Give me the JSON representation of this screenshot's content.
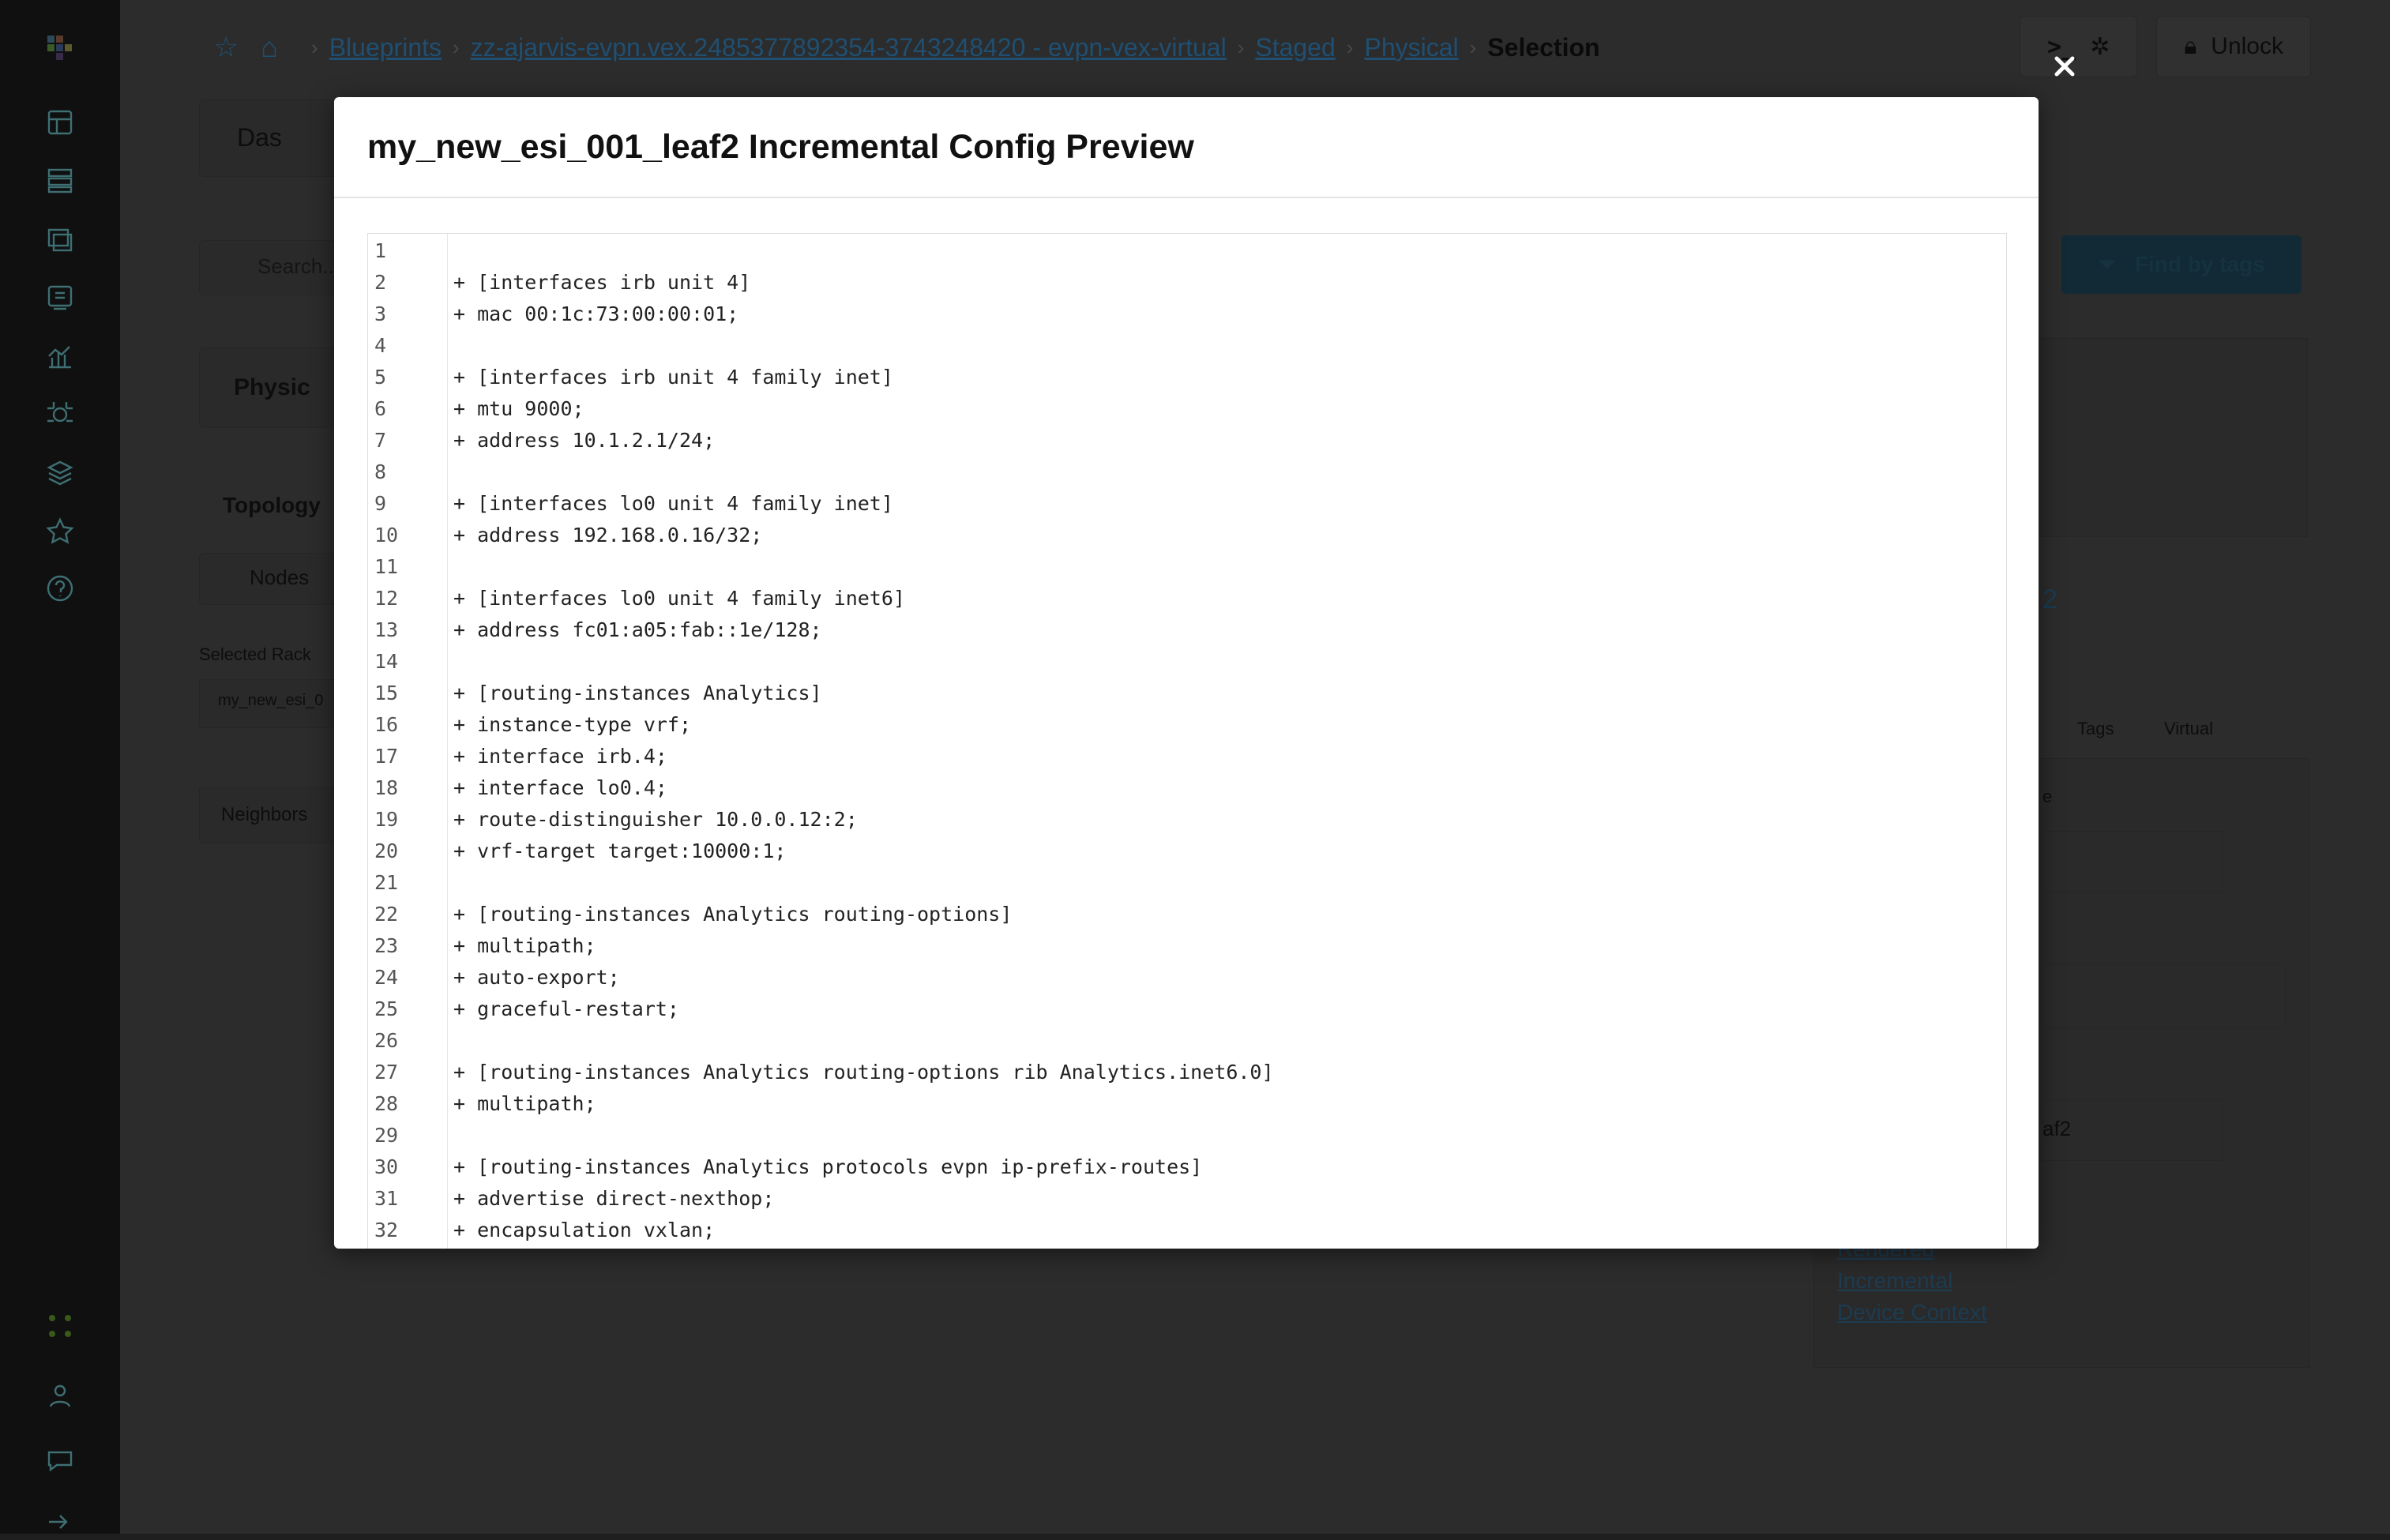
{
  "breadcrumb": {
    "items": [
      "Blueprints",
      "zz-ajarvis-evpn.vex.2485377892354-3743248420 - evpn-vex-virtual",
      "Staged",
      "Physical"
    ],
    "current": "Selection"
  },
  "header": {
    "unlock_label": "Unlock"
  },
  "background": {
    "dashboard_tab": "Das",
    "search_placeholder": "Search...",
    "find_by_tags": "Find by tags",
    "physical_tab": "Physic",
    "topology_tab": "Topology",
    "nodes_button": "Nodes",
    "selected_rack_label": "Selected Rack",
    "selected_rack_value": "my_new_esi_0",
    "neighbors_tab": "Neighbors",
    "device_link": "2",
    "col_tags": "Tags",
    "col_virtual": "Virtual",
    "col_e": "e",
    "row_leaf2": "af2",
    "links": [
      "Rendered",
      "Incremental",
      "Device Context"
    ]
  },
  "modal": {
    "title": "my_new_esi_001_leaf2 Incremental Config Preview",
    "lines": [
      {
        "n": "1",
        "t": ""
      },
      {
        "n": "2",
        "t": "+ [interfaces irb unit 4]"
      },
      {
        "n": "3",
        "t": "+ mac 00:1c:73:00:00:01;"
      },
      {
        "n": "4",
        "t": ""
      },
      {
        "n": "5",
        "t": "+ [interfaces irb unit 4 family inet]"
      },
      {
        "n": "6",
        "t": "+ mtu 9000;"
      },
      {
        "n": "7",
        "t": "+ address 10.1.2.1/24;"
      },
      {
        "n": "8",
        "t": ""
      },
      {
        "n": "9",
        "t": "+ [interfaces lo0 unit 4 family inet]"
      },
      {
        "n": "10",
        "t": "+ address 192.168.0.16/32;"
      },
      {
        "n": "11",
        "t": ""
      },
      {
        "n": "12",
        "t": "+ [interfaces lo0 unit 4 family inet6]"
      },
      {
        "n": "13",
        "t": "+ address fc01:a05:fab::1e/128;"
      },
      {
        "n": "14",
        "t": ""
      },
      {
        "n": "15",
        "t": "+ [routing-instances Analytics]"
      },
      {
        "n": "16",
        "t": "+ instance-type vrf;"
      },
      {
        "n": "17",
        "t": "+ interface irb.4;"
      },
      {
        "n": "18",
        "t": "+ interface lo0.4;"
      },
      {
        "n": "19",
        "t": "+ route-distinguisher 10.0.0.12:2;"
      },
      {
        "n": "20",
        "t": "+ vrf-target target:10000:1;"
      },
      {
        "n": "21",
        "t": ""
      },
      {
        "n": "22",
        "t": "+ [routing-instances Analytics routing-options]"
      },
      {
        "n": "23",
        "t": "+ multipath;"
      },
      {
        "n": "24",
        "t": "+ auto-export;"
      },
      {
        "n": "25",
        "t": "+ graceful-restart;"
      },
      {
        "n": "26",
        "t": ""
      },
      {
        "n": "27",
        "t": "+ [routing-instances Analytics routing-options rib Analytics.inet6.0]"
      },
      {
        "n": "28",
        "t": "+ multipath;"
      },
      {
        "n": "29",
        "t": ""
      },
      {
        "n": "30",
        "t": "+ [routing-instances Analytics protocols evpn ip-prefix-routes]"
      },
      {
        "n": "31",
        "t": "+ advertise direct-nexthop;"
      },
      {
        "n": "32",
        "t": "+ encapsulation vxlan;"
      }
    ]
  }
}
